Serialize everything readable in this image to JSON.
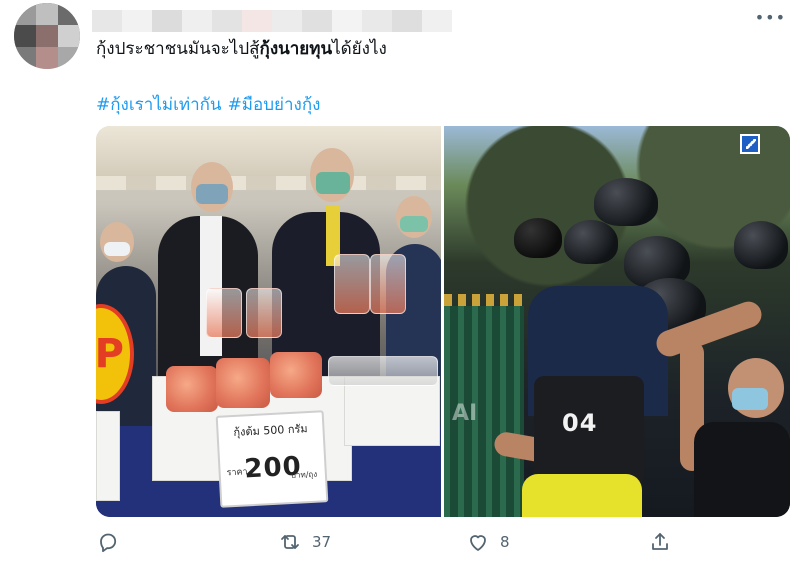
{
  "tweet": {
    "text_plain": "กุ้งประชาชนมันจะไปสู้",
    "text_bold": "กุ้งนายทุน",
    "text_tail": "ได้ยังไง",
    "hashtags": [
      "#กุ้งเราไม่เท่ากัน",
      "#มือบย่างกุ้ง"
    ]
  },
  "media": {
    "left_sign": {
      "line1": "กุ้งต้ม 500 กรัม",
      "price_prefix": "ราคา",
      "price": "200",
      "price_unit": "บาท/ถุง"
    },
    "left_p_sign": "P",
    "right_vest_number": "04",
    "right_watermark": "AI"
  },
  "actions": {
    "retweet_count": "37",
    "like_count": "8"
  },
  "icons": {
    "more": "more-icon",
    "reply": "reply-icon",
    "retweet": "retweet-icon",
    "like": "like-icon",
    "share": "share-icon"
  },
  "colors": {
    "hashtag": "#1d9bf0",
    "text": "#0f1419",
    "muted": "#536471"
  }
}
